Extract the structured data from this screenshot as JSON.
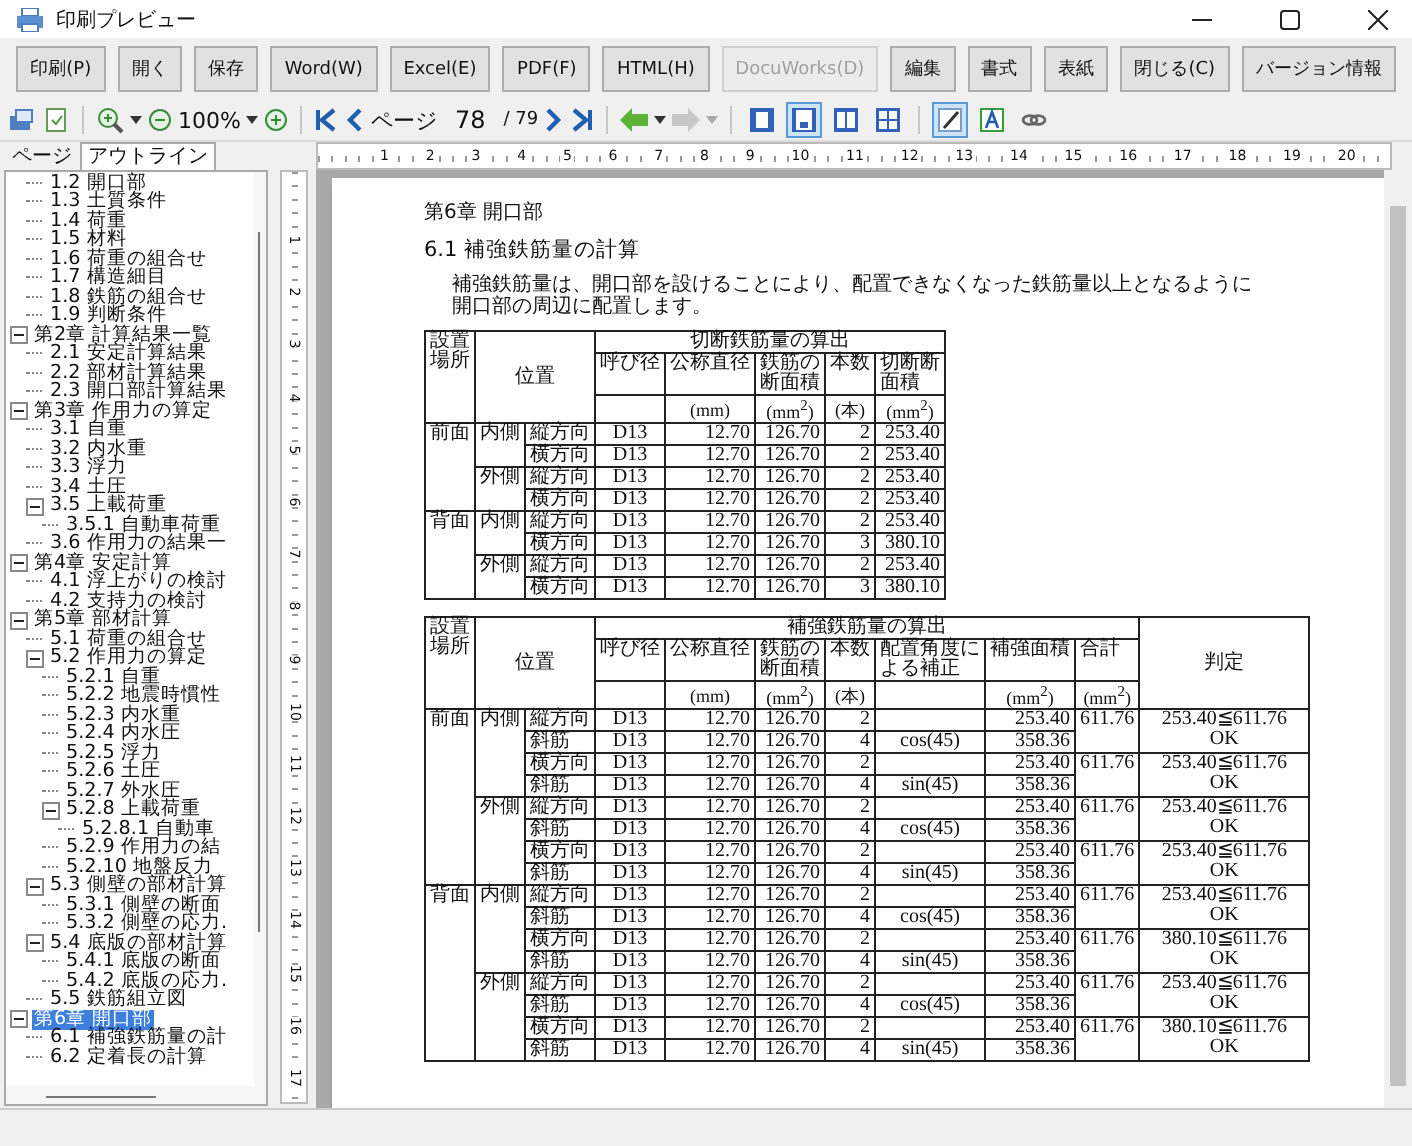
{
  "window": {
    "title": "印刷プレビュー"
  },
  "buttons": [
    {
      "label": "印刷(P)",
      "disabled": false
    },
    {
      "label": "開く",
      "disabled": false
    },
    {
      "label": "保存",
      "disabled": false
    },
    {
      "label": "Word(W)",
      "disabled": false
    },
    {
      "label": "Excel(E)",
      "disabled": false
    },
    {
      "label": "PDF(F)",
      "disabled": false
    },
    {
      "label": "HTML(H)",
      "disabled": false
    },
    {
      "label": "DocuWorks(D)",
      "disabled": true
    },
    {
      "label": "編集",
      "disabled": false
    },
    {
      "label": "書式",
      "disabled": false
    },
    {
      "label": "表紙",
      "disabled": false
    },
    {
      "label": "閉じる(C)",
      "disabled": false
    },
    {
      "label": "バージョン情報",
      "disabled": false
    }
  ],
  "toolbar": {
    "zoom": "100%",
    "page_label": "ページ",
    "page_number": "78",
    "page_total": "/ 79",
    "view_modes": [
      {
        "kind": "single",
        "selected": false
      },
      {
        "kind": "fit",
        "selected": true
      },
      {
        "kind": "double",
        "selected": false
      },
      {
        "kind": "quad",
        "selected": false
      }
    ],
    "tools": [
      {
        "kind": "pen",
        "selected": true
      },
      {
        "kind": "text",
        "selected": false
      },
      {
        "kind": "link",
        "selected": false
      }
    ]
  },
  "tabs": [
    {
      "label": "ページ",
      "selected": false
    },
    {
      "label": "アウトライン",
      "selected": true
    }
  ],
  "outline": [
    {
      "children": [
        {
          "label": "1.2 開口部",
          "selected": false
        },
        {
          "label": "1.3 土質条件",
          "selected": false
        },
        {
          "label": "1.4 荷重",
          "selected": false
        },
        {
          "label": "1.5 材料",
          "selected": false
        },
        {
          "label": "1.6 荷重の組合せ",
          "selected": false
        },
        {
          "label": "1.7 構造細目",
          "selected": false
        },
        {
          "label": "1.8 鉄筋の組合せ",
          "selected": false
        },
        {
          "label": "1.9 判断条件",
          "selected": false
        }
      ]
    },
    {
      "label": "第2章 計算結果一覧",
      "selected": false,
      "expanded": true,
      "children": [
        {
          "label": "2.1 安定計算結果",
          "selected": false
        },
        {
          "label": "2.2 部材計算結果",
          "selected": false
        },
        {
          "label": "2.3 開口部計算結果",
          "selected": false
        }
      ]
    },
    {
      "label": "第3章 作用力の算定",
      "selected": false,
      "expanded": true,
      "children": [
        {
          "label": "3.1 自重",
          "selected": false
        },
        {
          "label": "3.2 内水重",
          "selected": false
        },
        {
          "label": "3.3 浮力",
          "selected": false
        },
        {
          "label": "3.4 土圧",
          "selected": false
        },
        {
          "label": "3.5 上載荷重",
          "selected": false,
          "expanded": true,
          "children": [
            {
              "label": "3.5.1 自動車荷重",
              "selected": false
            }
          ]
        },
        {
          "label": "3.6 作用力の結果一",
          "selected": false
        }
      ]
    },
    {
      "label": "第4章 安定計算",
      "selected": false,
      "expanded": true,
      "children": [
        {
          "label": "4.1 浮上がりの検討",
          "selected": false
        },
        {
          "label": "4.2 支持力の検討",
          "selected": false
        }
      ]
    },
    {
      "label": "第5章 部材計算",
      "selected": false,
      "expanded": true,
      "children": [
        {
          "label": "5.1 荷重の組合せ",
          "selected": false
        },
        {
          "label": "5.2 作用力の算定",
          "selected": false,
          "expanded": true,
          "children": [
            {
              "label": "5.2.1 自重",
              "selected": false
            },
            {
              "label": "5.2.2 地震時慣性",
              "selected": false
            },
            {
              "label": "5.2.3 内水重",
              "selected": false
            },
            {
              "label": "5.2.4 内水圧",
              "selected": false
            },
            {
              "label": "5.2.5 浮力",
              "selected": false
            },
            {
              "label": "5.2.6 土圧",
              "selected": false
            },
            {
              "label": "5.2.7 外水圧",
              "selected": false
            },
            {
              "label": "5.2.8 上載荷重",
              "selected": false,
              "expanded": true,
              "children": [
                {
                  "label": "5.2.8.1 自動車",
                  "selected": false
                }
              ]
            },
            {
              "label": "5.2.9 作用力の結",
              "selected": false
            },
            {
              "label": "5.2.10 地盤反力",
              "selected": false
            }
          ]
        },
        {
          "label": "5.3 側壁の部材計算",
          "selected": false,
          "expanded": true,
          "children": [
            {
              "label": "5.3.1 側壁の断面",
              "selected": false
            },
            {
              "label": "5.3.2 側壁の応力.",
              "selected": false
            }
          ]
        },
        {
          "label": "5.4 底版の部材計算",
          "selected": false,
          "expanded": true,
          "children": [
            {
              "label": "5.4.1 底版の断面",
              "selected": false
            },
            {
              "label": "5.4.2 底版の応力.",
              "selected": false
            }
          ]
        },
        {
          "label": "5.5 鉄筋組立図",
          "selected": false
        }
      ]
    },
    {
      "label": "第6章 開口部",
      "selected": true,
      "expanded": true,
      "children": [
        {
          "label": "6.1 補強鉄筋量の計",
          "selected": false
        },
        {
          "label": "6.2 定着長の計算",
          "selected": false
        }
      ]
    }
  ],
  "ruler": {
    "horizontal": [
      "1",
      "2",
      "3",
      "4",
      "5",
      "6",
      "7",
      "8",
      "9",
      "10",
      "11",
      "12",
      "13",
      "14",
      "15",
      "16",
      "17",
      "18",
      "19",
      "20"
    ],
    "vertical": [
      "1",
      "2",
      "3",
      "4",
      "5",
      "6",
      "7",
      "8",
      "9",
      "10",
      "11",
      "12",
      "13",
      "14",
      "15",
      "16",
      "17"
    ]
  },
  "document": {
    "chapter": "第6章 開口部",
    "section": "6.1 補強鉄筋量の計算",
    "paragraph_lines": [
      "補強鉄筋量は、開口部を設けることにより、配置できなくなった鉄筋量以上となるように",
      "開口部の周辺に配置します。"
    ],
    "table1": {
      "title": "切断鉄筋量の算出",
      "head_location": "設置場所",
      "head_position": "位置",
      "columns": [
        {
          "label": "呼び径"
        },
        {
          "label": "公称直径",
          "unit": "(mm)"
        },
        {
          "label": "鉄筋の断面積",
          "unit": "(mm$^{2}$)"
        },
        {
          "label": "本数",
          "unit": "(本)"
        },
        {
          "label": "切断断面積",
          "unit": "(mm$^{2}$)"
        }
      ],
      "groups": [
        {
          "location": "前面",
          "sides": [
            {
              "side": "内側",
              "rows": [
                {
                  "direction": "縦方向",
                  "size": "D13",
                  "diameter": "12.70",
                  "area": "126.70",
                  "count": "2",
                  "result": "253.40"
                },
                {
                  "direction": "横方向",
                  "size": "D13",
                  "diameter": "12.70",
                  "area": "126.70",
                  "count": "2",
                  "result": "253.40"
                }
              ]
            },
            {
              "side": "外側",
              "rows": [
                {
                  "direction": "縦方向",
                  "size": "D13",
                  "diameter": "12.70",
                  "area": "126.70",
                  "count": "2",
                  "result": "253.40"
                },
                {
                  "direction": "横方向",
                  "size": "D13",
                  "diameter": "12.70",
                  "area": "126.70",
                  "count": "2",
                  "result": "253.40"
                }
              ]
            }
          ]
        },
        {
          "location": "背面",
          "sides": [
            {
              "side": "内側",
              "rows": [
                {
                  "direction": "縦方向",
                  "size": "D13",
                  "diameter": "12.70",
                  "area": "126.70",
                  "count": "2",
                  "result": "253.40"
                },
                {
                  "direction": "横方向",
                  "size": "D13",
                  "diameter": "12.70",
                  "area": "126.70",
                  "count": "3",
                  "result": "380.10"
                }
              ]
            },
            {
              "side": "外側",
              "rows": [
                {
                  "direction": "縦方向",
                  "size": "D13",
                  "diameter": "12.70",
                  "area": "126.70",
                  "count": "2",
                  "result": "253.40"
                },
                {
                  "direction": "横方向",
                  "size": "D13",
                  "diameter": "12.70",
                  "area": "126.70",
                  "count": "3",
                  "result": "380.10"
                }
              ]
            }
          ]
        }
      ]
    },
    "table2": {
      "title": "補強鉄筋量の算出",
      "head_location": "設置場所",
      "head_position": "位置",
      "head_judgement": "判定",
      "columns": [
        {
          "label": "呼び径"
        },
        {
          "label": "公称直径",
          "unit": "(mm)"
        },
        {
          "label": "鉄筋の断面積",
          "unit": "(mm$^{2}$)"
        },
        {
          "label": "本数",
          "unit": "(本)"
        },
        {
          "label": "配置角度による補正"
        },
        {
          "label": "補強面積",
          "unit": "(mm$^{2}$)"
        },
        {
          "label": "合計",
          "unit": "(mm$^{2}$)"
        }
      ],
      "groups": [
        {
          "location": "前面",
          "sides": [
            {
              "side": "内側",
              "pairs": [
                {
                  "total": "611.76",
                  "judgement": "253.40≦611.76",
                  "verdict": "OK",
                  "rows": [
                    {
                      "direction": "縦方向",
                      "size": "D13",
                      "diameter": "12.70",
                      "area": "126.70",
                      "count": "2",
                      "result": "253.40"
                    },
                    {
                      "direction": "斜筋",
                      "size": "D13",
                      "diameter": "12.70",
                      "area": "126.70",
                      "count": "4",
                      "correction": "cos(45)",
                      "result": "358.36"
                    }
                  ]
                },
                {
                  "total": "611.76",
                  "judgement": "253.40≦611.76",
                  "verdict": "OK",
                  "rows": [
                    {
                      "direction": "横方向",
                      "size": "D13",
                      "diameter": "12.70",
                      "area": "126.70",
                      "count": "2",
                      "result": "253.40"
                    },
                    {
                      "direction": "斜筋",
                      "size": "D13",
                      "diameter": "12.70",
                      "area": "126.70",
                      "count": "4",
                      "correction": "sin(45)",
                      "result": "358.36"
                    }
                  ]
                }
              ]
            },
            {
              "side": "外側",
              "pairs": [
                {
                  "total": "611.76",
                  "judgement": "253.40≦611.76",
                  "verdict": "OK",
                  "rows": [
                    {
                      "direction": "縦方向",
                      "size": "D13",
                      "diameter": "12.70",
                      "area": "126.70",
                      "count": "2",
                      "result": "253.40"
                    },
                    {
                      "direction": "斜筋",
                      "size": "D13",
                      "diameter": "12.70",
                      "area": "126.70",
                      "count": "4",
                      "correction": "cos(45)",
                      "result": "358.36"
                    }
                  ]
                },
                {
                  "total": "611.76",
                  "judgement": "253.40≦611.76",
                  "verdict": "OK",
                  "rows": [
                    {
                      "direction": "横方向",
                      "size": "D13",
                      "diameter": "12.70",
                      "area": "126.70",
                      "count": "2",
                      "result": "253.40"
                    },
                    {
                      "direction": "斜筋",
                      "size": "D13",
                      "diameter": "12.70",
                      "area": "126.70",
                      "count": "4",
                      "correction": "sin(45)",
                      "result": "358.36"
                    }
                  ]
                }
              ]
            }
          ]
        },
        {
          "location": "背面",
          "sides": [
            {
              "side": "内側",
              "pairs": [
                {
                  "total": "611.76",
                  "judgement": "253.40≦611.76",
                  "verdict": "OK",
                  "rows": [
                    {
                      "direction": "縦方向",
                      "size": "D13",
                      "diameter": "12.70",
                      "area": "126.70",
                      "count": "2",
                      "result": "253.40"
                    },
                    {
                      "direction": "斜筋",
                      "size": "D13",
                      "diameter": "12.70",
                      "area": "126.70",
                      "count": "4",
                      "correction": "cos(45)",
                      "result": "358.36"
                    }
                  ]
                },
                {
                  "total": "611.76",
                  "judgement": "380.10≦611.76",
                  "verdict": "OK",
                  "rows": [
                    {
                      "direction": "横方向",
                      "size": "D13",
                      "diameter": "12.70",
                      "area": "126.70",
                      "count": "2",
                      "result": "253.40"
                    },
                    {
                      "direction": "斜筋",
                      "size": "D13",
                      "diameter": "12.70",
                      "area": "126.70",
                      "count": "4",
                      "correction": "sin(45)",
                      "result": "358.36"
                    }
                  ]
                }
              ]
            },
            {
              "side": "外側",
              "pairs": [
                {
                  "total": "611.76",
                  "judgement": "253.40≦611.76",
                  "verdict": "OK",
                  "rows": [
                    {
                      "direction": "縦方向",
                      "size": "D13",
                      "diameter": "12.70",
                      "area": "126.70",
                      "count": "2",
                      "result": "253.40"
                    },
                    {
                      "direction": "斜筋",
                      "size": "D13",
                      "diameter": "12.70",
                      "area": "126.70",
                      "count": "4",
                      "correction": "cos(45)",
                      "result": "358.36"
                    }
                  ]
                },
                {
                  "total": "611.76",
                  "judgement": "380.10≦611.76",
                  "verdict": "OK",
                  "rows": [
                    {
                      "direction": "横方向",
                      "size": "D13",
                      "diameter": "12.70",
                      "area": "126.70",
                      "count": "2",
                      "result": "253.40"
                    },
                    {
                      "direction": "斜筋",
                      "size": "D13",
                      "diameter": "12.70",
                      "area": "126.70",
                      "count": "4",
                      "correction": "sin(45)",
                      "result": "358.36"
                    }
                  ]
                }
              ]
            }
          ]
        }
      ]
    }
  }
}
